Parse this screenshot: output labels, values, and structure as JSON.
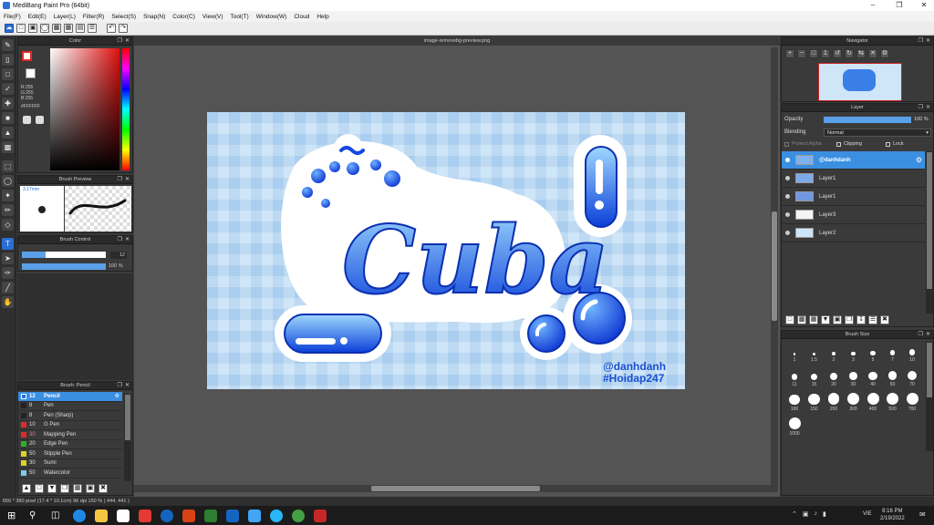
{
  "window": {
    "title": "MediBang Paint Pro (64bit)"
  },
  "menu": [
    "File(F)",
    "Edit(E)",
    "Layer(L)",
    "Filter(R)",
    "Select(S)",
    "Snap(N)",
    "Color(C)",
    "View(V)",
    "Tool(T)",
    "Window(W)",
    "Cloud",
    "Help"
  ],
  "document": {
    "tab_title": "image-removebg-preview.png"
  },
  "color_panel": {
    "title": "Color",
    "r": "R:255",
    "g": "G:255",
    "b": "B:255",
    "hex": "#FFFFFF"
  },
  "brush_preview": {
    "title": "Brush Preview",
    "size": "3.17mm"
  },
  "brush_control": {
    "title": "Brush Control",
    "size": "12",
    "opacity": "100 %",
    "size_fraction": 0.28,
    "opacity_fraction": 1.0
  },
  "brush_list": {
    "title": "Brush: Pencil",
    "items": [
      {
        "size": "12",
        "name": "Pencil",
        "color": "#2b6fd6",
        "selected": true
      },
      {
        "size": "8",
        "name": "Pen",
        "color": "#222222"
      },
      {
        "size": "8",
        "name": "Pen (Sharp)",
        "color": "#222222"
      },
      {
        "size": "10",
        "name": "G Pen",
        "color": "#e02a2a"
      },
      {
        "size": "30",
        "name": "Mapping Pen",
        "color": "#e02a2a"
      },
      {
        "size": "20",
        "name": "Edge Pen",
        "color": "#2bb02b"
      },
      {
        "size": "50",
        "name": "Stipple Pen",
        "color": "#e0d02a"
      },
      {
        "size": "30",
        "name": "Sumi",
        "color": "#e0d02a"
      },
      {
        "size": "50",
        "name": "Watercolor",
        "color": "#7fc9ef"
      }
    ]
  },
  "navigator": {
    "title": "Navigator"
  },
  "layer_panel": {
    "title": "Layer",
    "opacity_label": "Opacity",
    "opacity_value": "100 %",
    "blending_label": "Blending",
    "blending_value": "Normal",
    "protect_alpha": "Protect Alpha",
    "clipping": "Clipping",
    "lock": "Lock",
    "layers": [
      {
        "name": "@danhdanh",
        "selected": true
      },
      {
        "name": "Layer1"
      },
      {
        "name": "Layer1"
      },
      {
        "name": "Layer3"
      },
      {
        "name": "Layer2"
      }
    ]
  },
  "brush_size": {
    "title": "Brush Size",
    "sizes": [
      "1",
      "1.5",
      "2",
      "3",
      "5",
      "7",
      "10",
      "11",
      "15",
      "20",
      "30",
      "40",
      "50",
      "70",
      "100",
      "150",
      "200",
      "300",
      "400",
      "500",
      "700",
      "1000"
    ]
  },
  "artwork": {
    "word": "Cuba",
    "credit1": "@danhdanh",
    "credit2": "#Hoidap247"
  },
  "status": {
    "text": "656 * 380 pixel   (17.4 * 10.1cm)   96 dpi   150 %   ( 444, 441 )"
  },
  "taskbar": {
    "lang": "VIE",
    "time": "8:16 PM",
    "date": "2/19/2022"
  },
  "colors": {
    "accent": "#2b6fd6",
    "panel": "#3a3a3a",
    "canvas_bg": "#545454"
  }
}
